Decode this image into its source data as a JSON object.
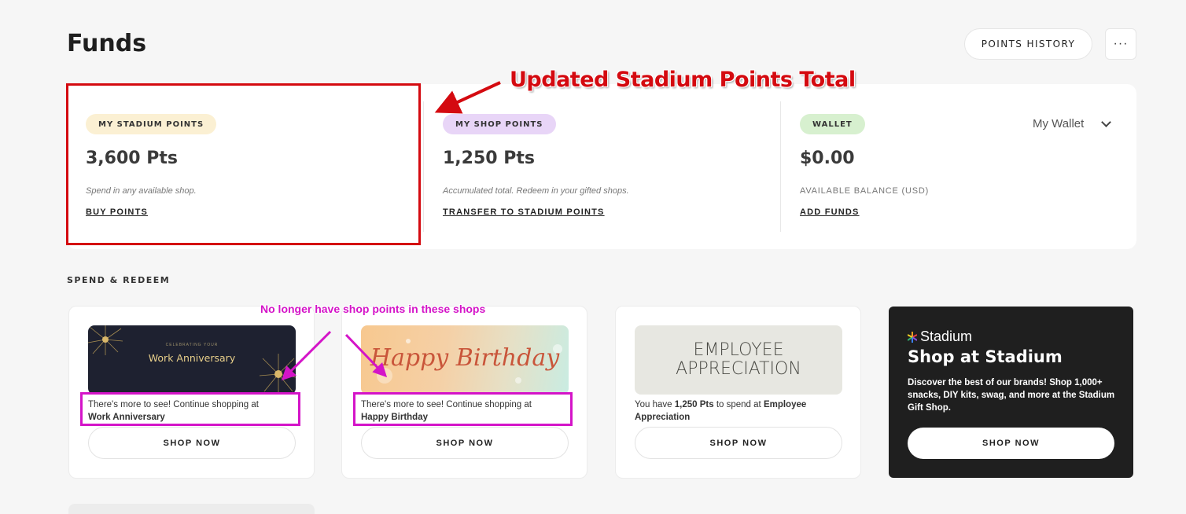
{
  "header": {
    "title": "Funds",
    "points_history_label": "POINTS HISTORY",
    "more_label": "···"
  },
  "funds": {
    "stadium": {
      "badge": "MY STADIUM POINTS",
      "amount": "3,600 Pts",
      "description": "Spend in any available shop.",
      "action": "BUY POINTS"
    },
    "shop": {
      "badge": "MY SHOP POINTS",
      "amount": "1,250 Pts",
      "description": "Accumulated total. Redeem in your gifted shops.",
      "action": "TRANSFER TO STADIUM POINTS"
    },
    "wallet": {
      "badge": "WALLET",
      "amount": "$0.00",
      "description": "AVAILABLE BALANCE (USD)",
      "action": "ADD FUNDS",
      "selector": "My Wallet"
    }
  },
  "section": {
    "label": "SPEND & REDEEM"
  },
  "shops": [
    {
      "image_title": "Work Anniversary",
      "image_small": "CELEBRATING YOUR",
      "desc_prefix": "There's more to see! Continue shopping at",
      "desc_bold": "Work Anniversary",
      "button": "SHOP NOW"
    },
    {
      "image_title": "Happy Birthday",
      "desc_prefix": "There's more to see! Continue shopping at",
      "desc_bold": "Happy Birthday",
      "button": "SHOP NOW"
    },
    {
      "image_title": "EMPLOYEE APPRECIATION",
      "desc_prefix": "You have",
      "desc_points": "1,250 Pts",
      "desc_middle": "to spend at",
      "desc_bold": "Employee Appreciation",
      "button": "SHOP NOW"
    }
  ],
  "stadium_promo": {
    "brand": "Stadium",
    "title": "Shop at Stadium",
    "description": "Discover the best of our brands! Shop 1,000+ snacks, DIY kits, swag, and more at the Stadium Gift Shop.",
    "button": "SHOP NOW"
  },
  "annotations": {
    "red_text": "Updated Stadium Points Total",
    "magenta_text": "No longer have shop points in these shops",
    "red_color": "#d40a10",
    "magenta_color": "#d414c8"
  },
  "colors": {
    "stadium_pill": "#fbf0d3",
    "shop_pill": "#e8d5f7",
    "wallet_pill": "#d7f0cf"
  }
}
